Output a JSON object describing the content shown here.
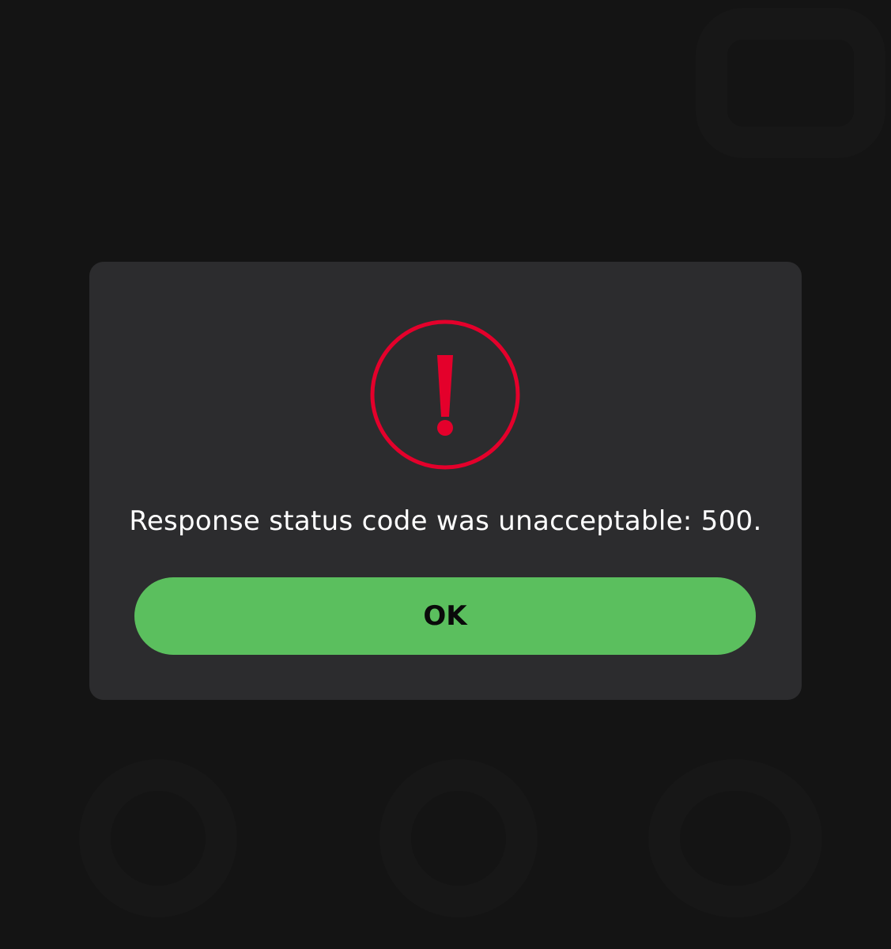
{
  "colors": {
    "background": "#141414",
    "dialog": "#2c2c2e",
    "alert": "#e4002b",
    "button": "#5bbf5e",
    "button_text": "#0a0a0a",
    "message_text": "#ffffff"
  },
  "dialog": {
    "icon": "exclamation-circle-icon",
    "message": "Response status code was unacceptable: 500.",
    "ok_label": "OK"
  }
}
